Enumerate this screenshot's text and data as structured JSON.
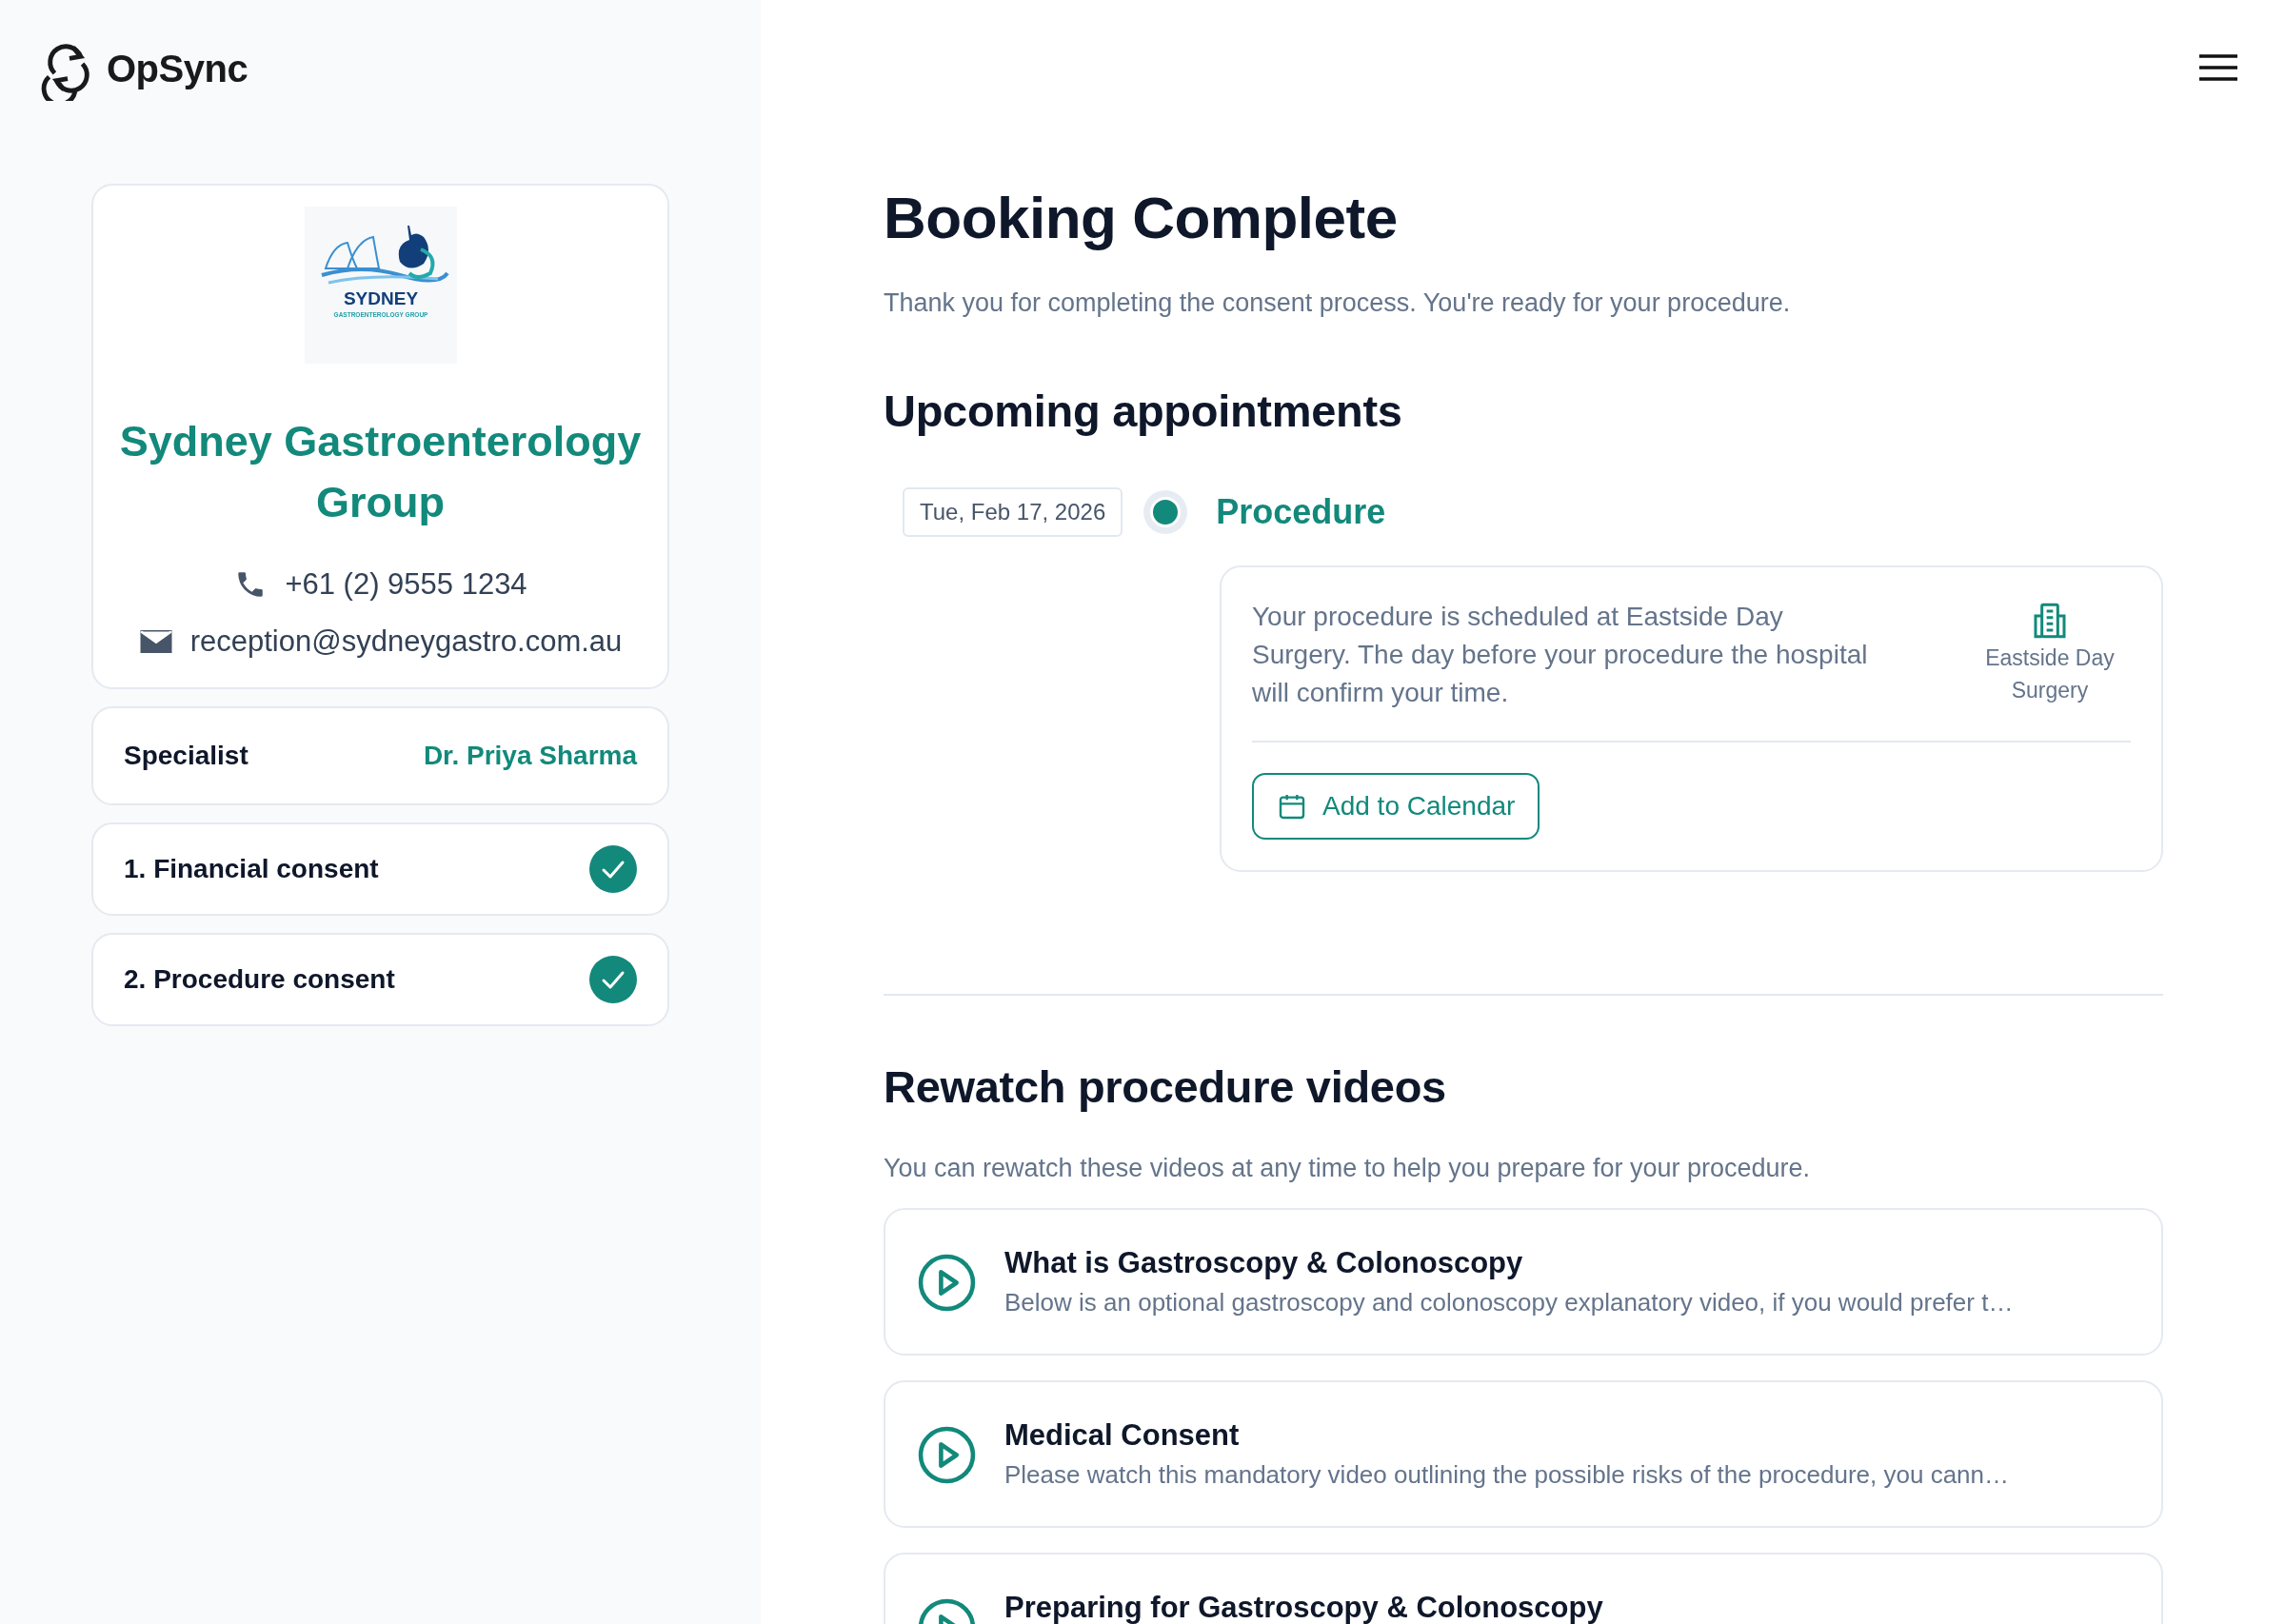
{
  "brand": {
    "name": "OpSync"
  },
  "clinic": {
    "logo_text": [
      "SYDNEY",
      "GASTROENTEROLOGY GROUP"
    ],
    "name": "Sydney Gastroenterology Group",
    "phone": "+61 (2) 9555 1234",
    "email": "reception@sydneygastro.com.au"
  },
  "specialist": {
    "label": "Specialist",
    "value": "Dr. Priya Sharma"
  },
  "steps": [
    {
      "label": "1. Financial consent",
      "completed": true
    },
    {
      "label": "2. Procedure consent",
      "completed": true
    }
  ],
  "title": "Booking Complete",
  "subtitle": "Thank you for completing the consent process. You're ready for your procedure.",
  "appointments_heading": "Upcoming appointments",
  "appointments": [
    {
      "date": "Tue, Feb 17, 2026",
      "type": "Procedure",
      "description": "Your procedure is scheduled at Eastside Day Surgery. The day before your procedure the hospital will confirm your time.",
      "location": "Eastside Day Surgery",
      "button": "Add to Calendar"
    }
  ],
  "videos_heading": "Rewatch procedure videos",
  "videos_subtitle": "You can rewatch these videos at any time to help you prepare for your procedure.",
  "videos": [
    {
      "title": "What is Gastroscopy & Colonoscopy",
      "description": "Below is an optional gastroscopy and colonoscopy explanatory video, if you would prefer t…"
    },
    {
      "title": "Medical Consent",
      "description": "Please watch this mandatory video outlining the possible risks of the procedure, you cann…"
    },
    {
      "title": "Preparing for Gastroscopy & Colonoscopy"
    }
  ]
}
